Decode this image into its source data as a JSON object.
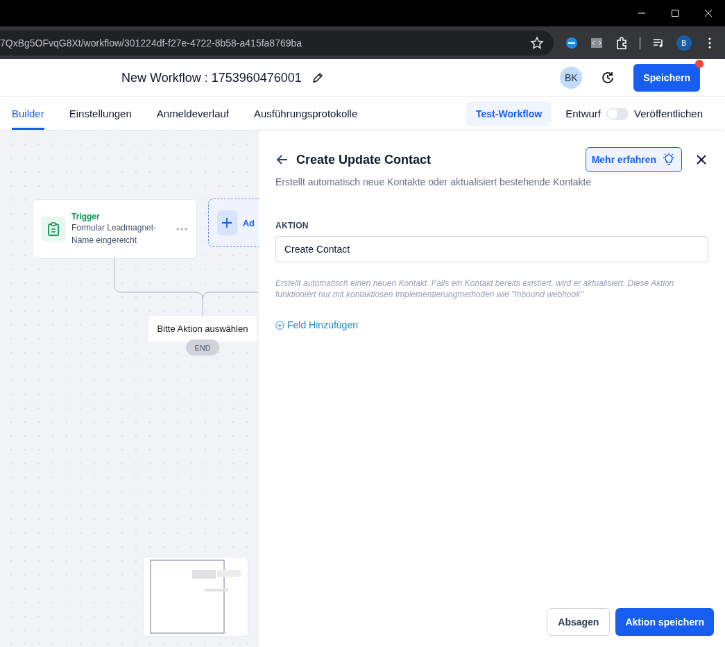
{
  "browser": {
    "url": "7QxBg5OFvqG8Xt/workflow/301224df-f27e-4722-8b58-a415fa8769ba",
    "profile": "B"
  },
  "header": {
    "title": "New Workflow : 1753960476001",
    "avatar": "BK",
    "save_button": "Speichern",
    "has_notification": true
  },
  "tabs": [
    {
      "label": "Builder",
      "selected": true
    },
    {
      "label": "Einstellungen",
      "selected": false
    },
    {
      "label": "Anmeldeverlauf",
      "selected": false
    },
    {
      "label": "Ausführungsprotokolle",
      "selected": false
    }
  ],
  "toolbar": {
    "test_button": "Test-Workflow",
    "draft_label": "Entwurf",
    "publish_toggle": {
      "on": false
    },
    "publish_label": "Veröffentlichen"
  },
  "canvas": {
    "trigger_node": {
      "title": "Trigger",
      "subtitle": "Formular Leadmagnet-Name eingereicht"
    },
    "add_node": {
      "label": "Ad"
    },
    "action_placeholder": "Bitte Aktion auswählen",
    "end_label": "END"
  },
  "panel": {
    "title": "Create Update Contact",
    "subtitle": "Erstellt automatisch neue Kontakte oder aktualisiert bestehende Kontakte",
    "learn_more": "Mehr erfahren",
    "field_label": "AKTION",
    "field_value": "Create Contact",
    "help_text": "Erstellt automatisch einen neuen Kontakt. Falls ein Kontakt bereits existiert, wird er aktualisiert. Diese Aktion funktioniert nur mit kontaktlosen Implementierungmethoden wie \"Inbound webhook\"",
    "add_field": "Feld Hinzufügen",
    "cancel_button": "Absagen",
    "save_button": "Aktion speichern"
  }
}
